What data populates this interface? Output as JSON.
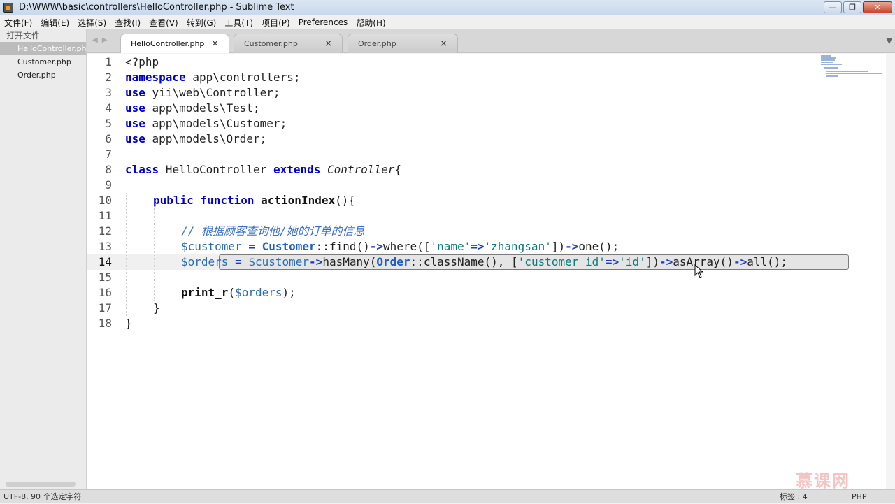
{
  "window": {
    "title": "D:\\WWW\\basic\\controllers\\HelloController.php - Sublime Text"
  },
  "menu": [
    "文件(F)",
    "编辑(E)",
    "选择(S)",
    "查找(I)",
    "查看(V)",
    "转到(G)",
    "工具(T)",
    "项目(P)",
    "Preferences",
    "帮助(H)"
  ],
  "sidebar": {
    "header": "打开文件",
    "files": [
      "HelloController.php",
      "Customer.php",
      "Order.php"
    ],
    "active_index": 0
  },
  "tabs": [
    {
      "label": "HelloController.php",
      "active": true
    },
    {
      "label": "Customer.php",
      "active": false
    },
    {
      "label": "Order.php",
      "active": false
    }
  ],
  "editor": {
    "line_numbers": [
      "1",
      "2",
      "3",
      "4",
      "5",
      "6",
      "7",
      "8",
      "9",
      "10",
      "11",
      "12",
      "13",
      "14",
      "15",
      "16",
      "17",
      "18"
    ],
    "current_line": 14,
    "code": {
      "l1": "<?php",
      "l2_kw": "namespace",
      "l2_rest": " app\\controllers;",
      "l3_kw": "use",
      "l3_rest": " yii\\web\\Controller;",
      "l4_kw": "use",
      "l4_rest": " app\\models\\Test;",
      "l5_kw": "use",
      "l5_rest": " app\\models\\Customer;",
      "l6_kw": "use",
      "l6_rest": " app\\models\\Order;",
      "l8_kw1": "class",
      "l8_name": " HelloController ",
      "l8_kw2": "extends",
      "l8_parent": " Controller",
      "l8_brace": "{",
      "l10_kw1": "public",
      "l10_kw2": "function",
      "l10_name": "actionIndex",
      "l10_rest": "(){",
      "l12_comment": "// 根据顾客查询他/她的订单的信息",
      "l13_var": "$customer",
      "l13_eq": " = ",
      "l13_cls": "Customer",
      "l13_a": "::find()",
      "l13_arrow1": "->",
      "l13_b": "where([",
      "l13_s1": "'name'",
      "l13_op": "=>",
      "l13_s2": "'zhangsan'",
      "l13_c": "])",
      "l13_arrow2": "->",
      "l13_d": "one();",
      "l14_var": "$orders",
      "l14_eq": " = ",
      "l14_var2": "$customer",
      "l14_arrow1": "->",
      "l14_a": "hasMany(",
      "l14_cls": "Order",
      "l14_b": "::className(), [",
      "l14_s1": "'customer_id'",
      "l14_op": "=>",
      "l14_s2": "'id'",
      "l14_c": "])",
      "l14_arrow2": "->",
      "l14_d": "asArray()",
      "l14_arrow3": "->",
      "l14_e": "all();",
      "l16_fn": "print_r",
      "l16_a": "(",
      "l16_var": "$orders",
      "l16_b": ");",
      "l17": "}",
      "l18": "}"
    }
  },
  "status": {
    "left": "UTF-8, 90  个选定字符",
    "tab_size": "标签 : 4",
    "syntax": "PHP"
  },
  "watermark": "慕课网"
}
